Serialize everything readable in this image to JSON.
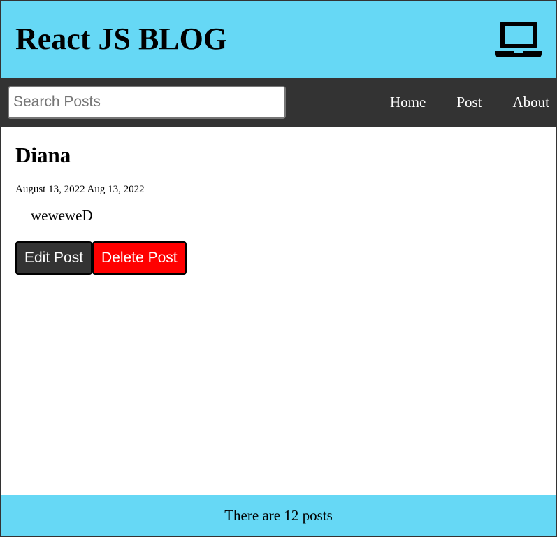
{
  "header": {
    "title": "React JS BLOG",
    "icon": "laptop-icon"
  },
  "nav": {
    "search_placeholder": "Search Posts",
    "search_value": "",
    "links": [
      "Home",
      "Post",
      "About"
    ]
  },
  "post": {
    "title": "Diana",
    "date": "August 13, 2022 Aug 13, 2022",
    "body": "weweweD",
    "edit_label": "Edit Post",
    "delete_label": "Delete Post"
  },
  "footer": {
    "text": "There are 12 posts"
  },
  "colors": {
    "header_bg": "#66d8f5",
    "nav_bg": "#333333",
    "edit_button_bg": "#333333",
    "delete_button_bg": "#ff0000",
    "footer_bg": "#66d8f5"
  }
}
